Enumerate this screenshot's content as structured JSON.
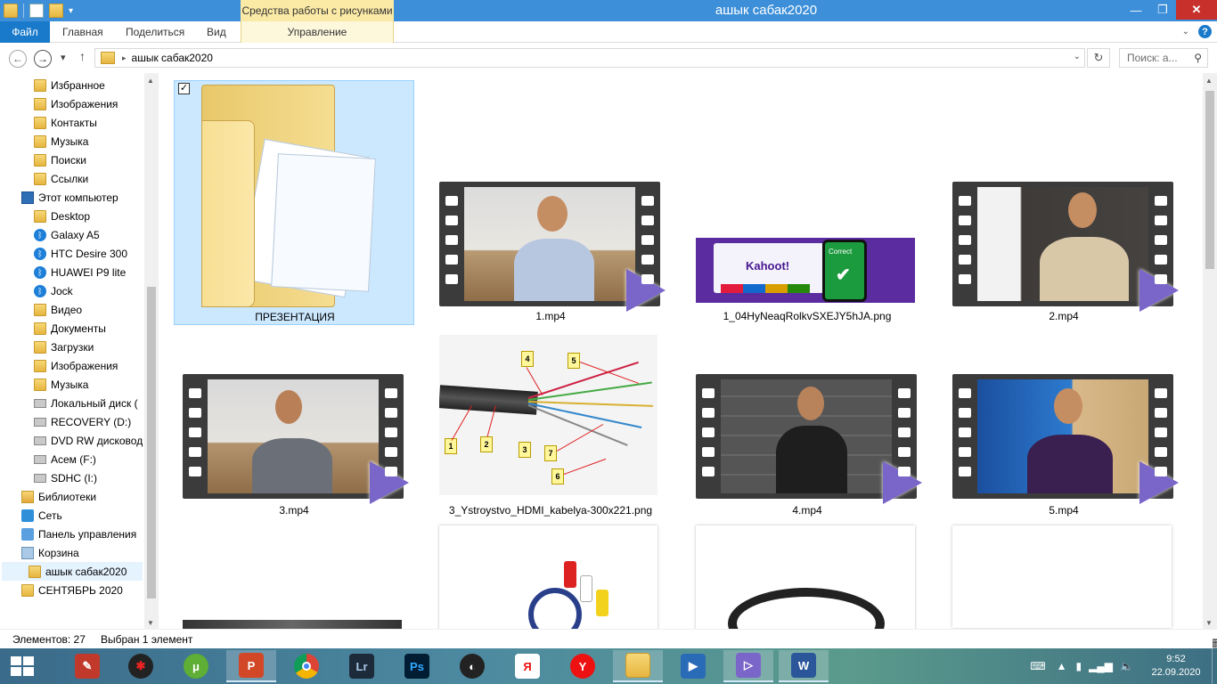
{
  "window": {
    "title": "ашык сабак2020",
    "context_tab": "Средства работы с рисунками"
  },
  "ribbon": {
    "tabs": [
      "Файл",
      "Главная",
      "Поделиться",
      "Вид",
      "Управление"
    ]
  },
  "address": {
    "crumb": "ашык сабак2020",
    "search_placeholder": "Поиск: а..."
  },
  "nav": {
    "items": [
      {
        "label": "Избранное",
        "icon": "folder-icon"
      },
      {
        "label": "Изображения",
        "icon": "folder-icon"
      },
      {
        "label": "Контакты",
        "icon": "folder-icon"
      },
      {
        "label": "Музыка",
        "icon": "folder-icon"
      },
      {
        "label": "Поиски",
        "icon": "folder-icon"
      },
      {
        "label": "Ссылки",
        "icon": "folder-icon"
      },
      {
        "label": "Этот компьютер",
        "icon": "computer-icon"
      },
      {
        "label": "Desktop",
        "icon": "folder-icon"
      },
      {
        "label": "Galaxy A5",
        "icon": "bluetooth-icon"
      },
      {
        "label": "HTC Desire 300",
        "icon": "bluetooth-icon"
      },
      {
        "label": "HUAWEI P9 lite",
        "icon": "bluetooth-icon"
      },
      {
        "label": "Jock",
        "icon": "bluetooth-icon"
      },
      {
        "label": "Видео",
        "icon": "folder-icon"
      },
      {
        "label": "Документы",
        "icon": "folder-icon"
      },
      {
        "label": "Загрузки",
        "icon": "folder-icon"
      },
      {
        "label": "Изображения",
        "icon": "folder-icon"
      },
      {
        "label": "Музыка",
        "icon": "folder-icon"
      },
      {
        "label": "Локальный диск (",
        "icon": "windows-drive-icon"
      },
      {
        "label": "RECOVERY (D:)",
        "icon": "drive-icon"
      },
      {
        "label": "DVD RW дисковод",
        "icon": "dvd-drive-icon"
      },
      {
        "label": "Асем (F:)",
        "icon": "drive-icon"
      },
      {
        "label": "SDHC (I:)",
        "icon": "drive-icon"
      },
      {
        "label": "Библиотеки",
        "icon": "library-icon"
      },
      {
        "label": "Сеть",
        "icon": "network-icon"
      },
      {
        "label": "Панель управления",
        "icon": "control-panel-icon"
      },
      {
        "label": "Корзина",
        "icon": "recycle-bin-icon"
      },
      {
        "label": "ашык сабак2020",
        "icon": "folder-icon",
        "selected": true
      },
      {
        "label": "СЕНТЯБРЬ 2020",
        "icon": "folder-icon"
      }
    ]
  },
  "files": [
    {
      "name": "ПРЕЗЕНТАЦИЯ",
      "type": "folder",
      "selected": true
    },
    {
      "name": "1.mp4",
      "type": "video"
    },
    {
      "name": "1_04HyNeaqRolkvSXEJY5hJA.png",
      "type": "image",
      "kahoot_text": "Kahoot!",
      "correct_text": "Correct"
    },
    {
      "name": "2.mp4",
      "type": "video"
    },
    {
      "name": "3.mp4",
      "type": "video"
    },
    {
      "name": "3_Ystroystvo_HDMI_kabelya-300x221.png",
      "type": "image",
      "labels": [
        "1",
        "2",
        "3",
        "4",
        "5",
        "6",
        "7"
      ]
    },
    {
      "name": "4.mp4",
      "type": "video"
    },
    {
      "name": "5.mp4",
      "type": "video"
    }
  ],
  "status": {
    "count": "Элементов: 27",
    "selection": "Выбран 1 элемент"
  },
  "taskbar": {
    "apps": [
      "IrfanView",
      "Media",
      "uTorrent",
      "PowerPoint",
      "Chrome",
      "Lightroom",
      "Photoshop",
      "OBS",
      "Yandex",
      "Yandex Browser",
      "File Explorer",
      "Video Editor",
      "Media Player",
      "Word"
    ],
    "time": "9:52",
    "date": "22.09.2020"
  },
  "colors": {
    "titlebar": "#3c8fd8",
    "file_tab": "#1979ca",
    "selection": "#cce8ff",
    "video_play": "#7a66c9"
  }
}
